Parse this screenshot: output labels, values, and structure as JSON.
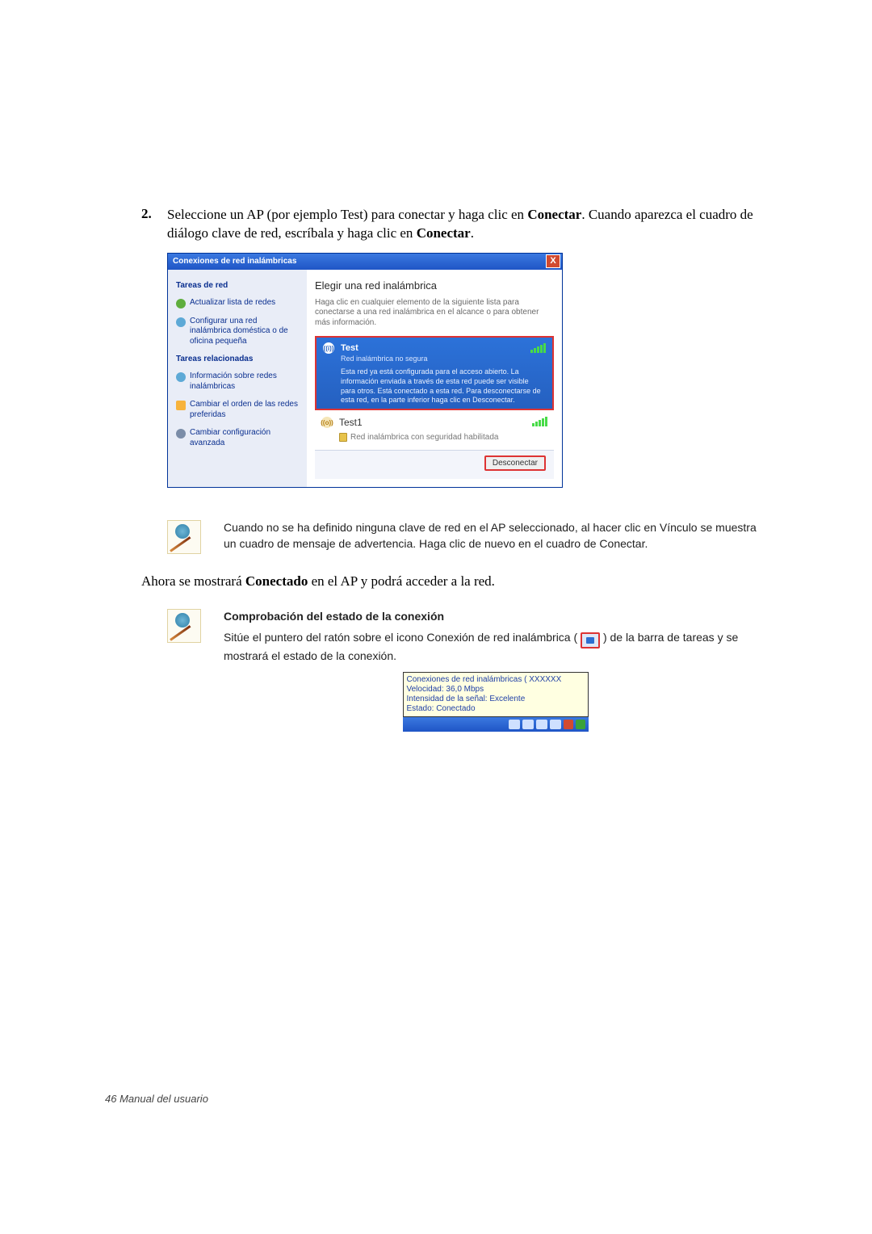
{
  "step": {
    "num": "2.",
    "text_1": "Seleccione un AP (por ejemplo Test) para conectar y haga clic en ",
    "bold_1": "Conectar",
    "text_2": ". Cuando aparezca el cuadro de diálogo clave de red, escríbala y haga clic en ",
    "bold_2": "Conectar",
    "text_3": "."
  },
  "dlg": {
    "title": "Conexiones de red inalámbricas",
    "close": "X",
    "side": {
      "h1": "Tareas de red",
      "i1": "Actualizar lista de redes",
      "i2": "Configurar una red inalámbrica doméstica o de oficina pequeña",
      "h2": "Tareas relacionadas",
      "i3": "Información sobre redes inalámbricas",
      "i4": "Cambiar el orden de las redes preferidas",
      "i5": "Cambiar configuración avanzada"
    },
    "main": {
      "h": "Elegir una red inalámbrica",
      "p": "Haga clic en cualquier elemento de la siguiente lista para conectarse a una red inalámbrica en el alcance o para obtener más información.",
      "net1": {
        "name": "Test",
        "sub": "Red inalámbrica no segura",
        "desc": "Esta red ya está configurada para el acceso abierto. La información enviada a través de esta red puede ser visible para otros. Está conectado a esta red. Para desconectarse de esta red, en la parte inferior haga clic en Desconectar."
      },
      "net2": {
        "name": "Test1",
        "sub": "Red inalámbrica con seguridad habilitada"
      },
      "btn": "Desconectar"
    }
  },
  "note1": "Cuando no se ha definido ninguna clave de red en el AP seleccionado, al hacer clic en Vínculo se muestra un cuadro de mensaje de advertencia. Haga clic de nuevo en el cuadro de Conectar.",
  "para2_a": "Ahora se mostrará ",
  "para2_b": "Conectado",
  "para2_c": " en el AP y podrá acceder a la red.",
  "note2": {
    "h": "Comprobación del estado de la conexión",
    "p1": "Sitúe el puntero del ratón sobre el icono Conexión de red inalámbrica (",
    "p2": ") de la barra de tareas y se mostrará el estado de la conexión."
  },
  "tooltip": {
    "l1": "Conexiones de red inalámbricas (  XXXXXX",
    "l2": "Velocidad: 36,0 Mbps",
    "l3": "Intensidad de la señal: Excelente",
    "l4": "Estado: Conectado"
  },
  "footer": "46  Manual del usuario"
}
